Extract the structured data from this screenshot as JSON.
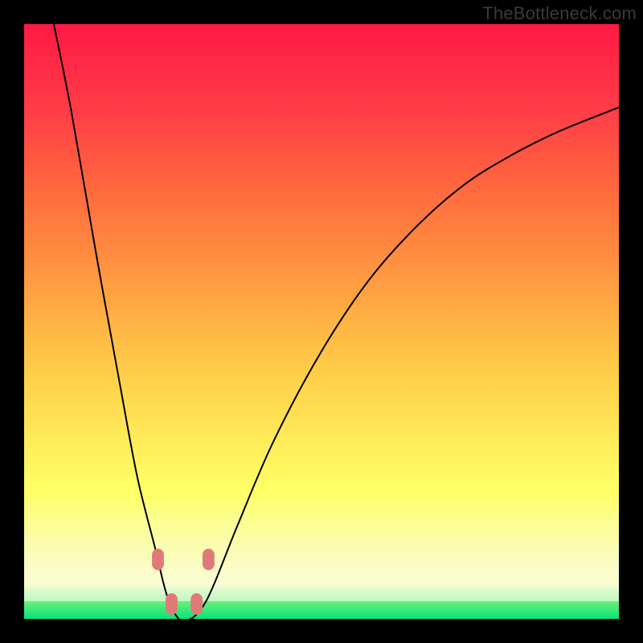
{
  "attribution": "TheBottleneck.com",
  "chart_data": {
    "type": "line",
    "title": "",
    "xlabel": "",
    "ylabel": "",
    "xlim": [
      0,
      100
    ],
    "ylim": [
      0,
      100
    ],
    "series": [
      {
        "name": "bottleneck-curve",
        "x": [
          5,
          8,
          12,
          16,
          19,
          22,
          24,
          26,
          28,
          30,
          32,
          36,
          42,
          50,
          58,
          66,
          74,
          82,
          90,
          100
        ],
        "values": [
          100,
          85,
          62,
          40,
          24,
          12,
          4,
          0,
          0,
          2,
          6,
          16,
          30,
          45,
          57,
          66,
          73,
          78,
          82,
          86
        ]
      }
    ],
    "markers": [
      {
        "x": 22.5,
        "y": 10,
        "shape": "rounded-square"
      },
      {
        "x": 31.0,
        "y": 10,
        "shape": "rounded-square"
      },
      {
        "x": 24.8,
        "y": 2.5,
        "shape": "rounded-square"
      },
      {
        "x": 29.0,
        "y": 2.5,
        "shape": "rounded-square"
      }
    ],
    "background_gradient": {
      "stops": [
        {
          "pos": 0,
          "color": "#05e27b"
        },
        {
          "pos": 3,
          "color": "#6ef07a"
        },
        {
          "pos": 6,
          "color": "#f6fbb0"
        },
        {
          "pos": 22,
          "color": "#ffff66"
        },
        {
          "pos": 40,
          "color": "#ffd24a"
        },
        {
          "pos": 62,
          "color": "#ff8a3f"
        },
        {
          "pos": 85,
          "color": "#ff3e47"
        },
        {
          "pos": 100,
          "color": "#ff1a44"
        }
      ]
    },
    "colors": {
      "curve": "#000000",
      "marker_fill": "#e07a78",
      "frame": "#000000"
    }
  }
}
